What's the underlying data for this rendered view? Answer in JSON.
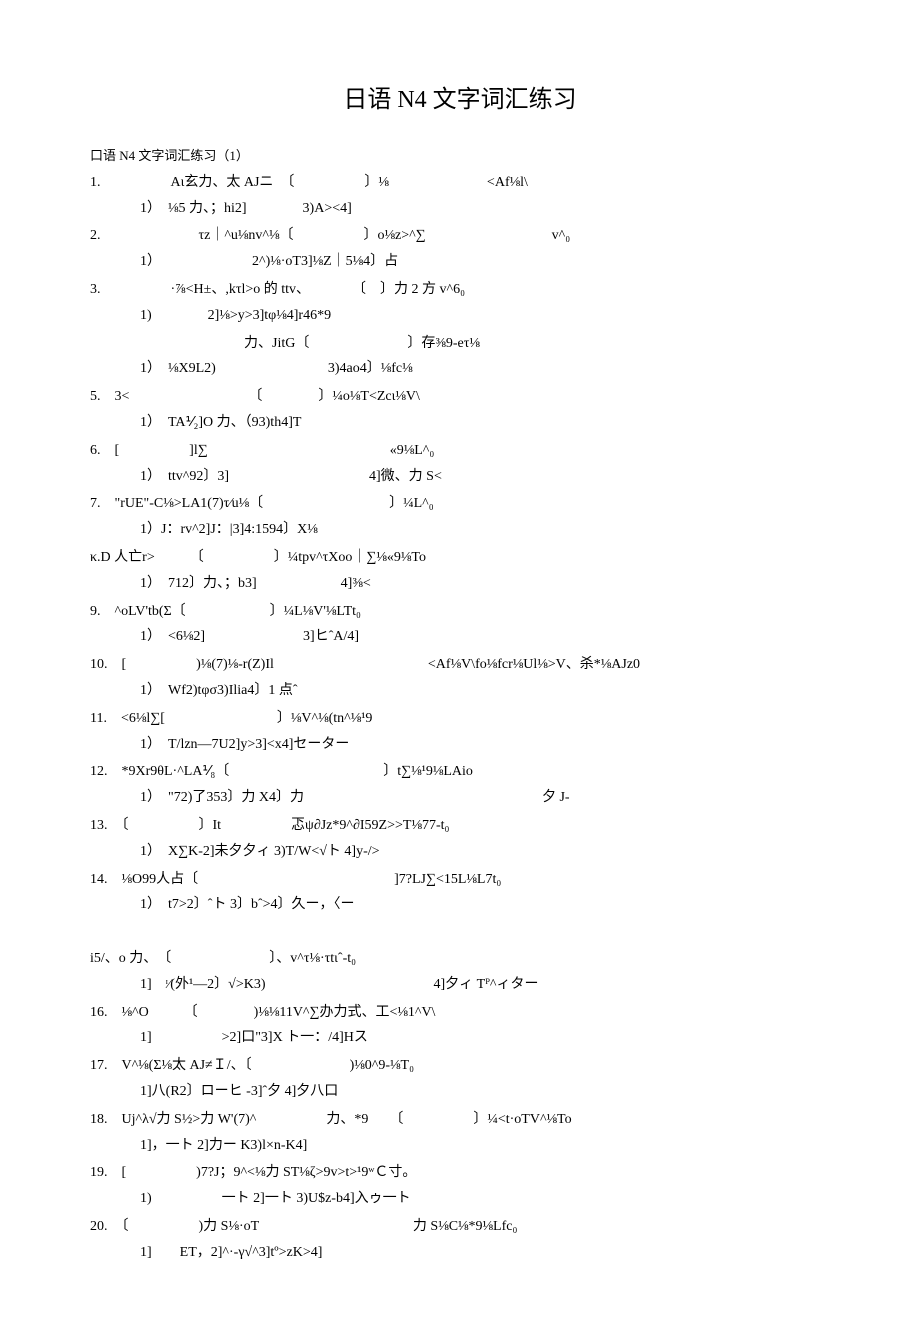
{
  "title": "日语 N4 文字词汇练习",
  "subtitle": "口语 N4 文字词汇练习（1）",
  "items": [
    {
      "q": "1.　　　　　Aι玄力、太 AJニ　〔　　　　　〕⅛　　　　　　　<Af⅛l\\",
      "a": "1）　⅛5 力、；hi2]　　　　3)A><4]"
    },
    {
      "q": "2.　　　　　　　τz｜^u⅛nv^⅛〔　　　　　〕o⅛z>^∑　　　　　　　　　v^₀",
      "a": "1）　　　　　　　2^)⅛·oT3]⅛Z｜5⅛4〕占"
    },
    {
      "q": "3.　　　　　·⅞<H±、,kτl>o 的 ttv、　　　　〔　〕力 2 方 v^6₀",
      "a": "1)　　　　2]⅛>y>3]tφ⅛4]r46*9"
    },
    {
      "q": "　　　　　　　　　　　力、JitG〔　　　　　　　〕存⅜9-eτ⅛",
      "a": "1）　⅛X9L2)　　　　　　　　3)4ao4〕⅛fc⅛"
    },
    {
      "q": "5.　3<　　　　　　　　　〔　　　　〕¼o⅛T<Zcι⅛V\\",
      "a": "1）　TA⅟₂]O 力、（93)th4]T"
    },
    {
      "q": "6.　[　　　　　]l∑　　　　　　　　　　　　　«9⅛L^₀",
      "a": "1）　ttv^92〕3]　　　　　　　　　　4]微、力 S<"
    },
    {
      "q": "7.　\"rUE\"-C⅛>LA1(7)τ⁄u⅛〔　　　　　　　　　〕¼L^₀",
      "a": "1）J：rv^2]J：|3]4:1594〕X⅛"
    },
    {
      "q": "κ.D 人亡r>　　　〔　　　　　〕¼tpv^τXoo｜∑⅛«9⅛To",
      "a": "1）　712〕力、；b3]　　　　　　4]⅜<"
    },
    {
      "q": "9.　^oLV'tb(Σ〔　　　　　　〕¼L⅛V'⅛LTt₀",
      "a": "1）　<6⅛2]　　　　　　　3]ヒˆA/4]"
    },
    {
      "q": "10.　[　　　　　)⅛(7)⅛-r(Z)Il　　　　　　　　　　　<Af⅛V\\fo⅛fcr⅛Ul⅛>V、杀*⅛AJz0",
      "a": "1）　Wf2)tφσ3)Ilia4〕1 点ˆ"
    },
    {
      "q": "11.　<6⅛l∑[　　　　　　　　〕⅛V^⅛(tn^⅛¹9",
      "a": "1）　T/lzn—7U2]y>3]<x4]セーター"
    },
    {
      "q": "12.　*9Xr9θL·^LA⅟₈〔　　　　　　　　　　　〕t∑⅛¹9⅛LAio",
      "a": "1）　\"72)了353〕力 X4〕力　　　　　　　　　　　　　　　　　夕 J-"
    },
    {
      "q": "13.　〔　　　　　〕It　　　　　忑ψ∂Jz*9^∂I59Z>>T⅛77-t₀",
      "a": "1）　X∑K-2]未夕夕ィ 3)T/W<√ト 4]y-/>"
    },
    {
      "q": "14.　⅛O99人占〔　　　　　　　　　　　　　　]7?LJ∑<15L⅛L7t₀",
      "a": "1）　t7>2〕ˆト 3〕bˆ>4〕久ー，〈ー"
    },
    {
      "q": "　",
      "a": ""
    },
    {
      "q": "i5/、o 力、　〔　　　　　　　〕、v^τ⅛·τtιˆ-t₀",
      "a": "1]　ᶦ⁄(外¹—2〕√>K3)　　　　　　　　　　　　4]夕ィ Tᴾ^ィター"
    },
    {
      "q": "16.　⅛^O　　　〔　　　　)⅛⅛11V^∑办力式、工<⅛1^V\\",
      "a": "1]　　　　　>2]口\"3]X ト一：/4]Hス"
    },
    {
      "q": "17.　V^⅛(Σ⅛太 AJ≠Ｉ/、〔　　　　　　　)⅛0^9-⅛T₀",
      "a": "1]八(R2〕ローヒ -3]ˆ夕 4]夕八口"
    },
    {
      "q": "18.　Uj^λ√力 S½>力 W'(7)^　　　　　力、*9　　〔　　　　　〕¼<t·oTV^⅛To",
      "a": "1]，一ト 2]力ー K3)l×n-K4]"
    },
    {
      "q": "19.　[　　　　　)7?J；9^<⅛力 ST⅛ζ>9v>t>¹9ʷＣ寸。",
      "a": "1)　　　　　一ト 2]一ト 3)U$z-b4]入ゥ一ト"
    },
    {
      "q": "20.　〔　　　　　)力 S⅛·oT　　　　　　　　　　　力 S⅛C⅛*9⅛Lfc₀",
      "a": "1]　　ET，2]^·-γ√^3]tº>zK>4]"
    }
  ]
}
